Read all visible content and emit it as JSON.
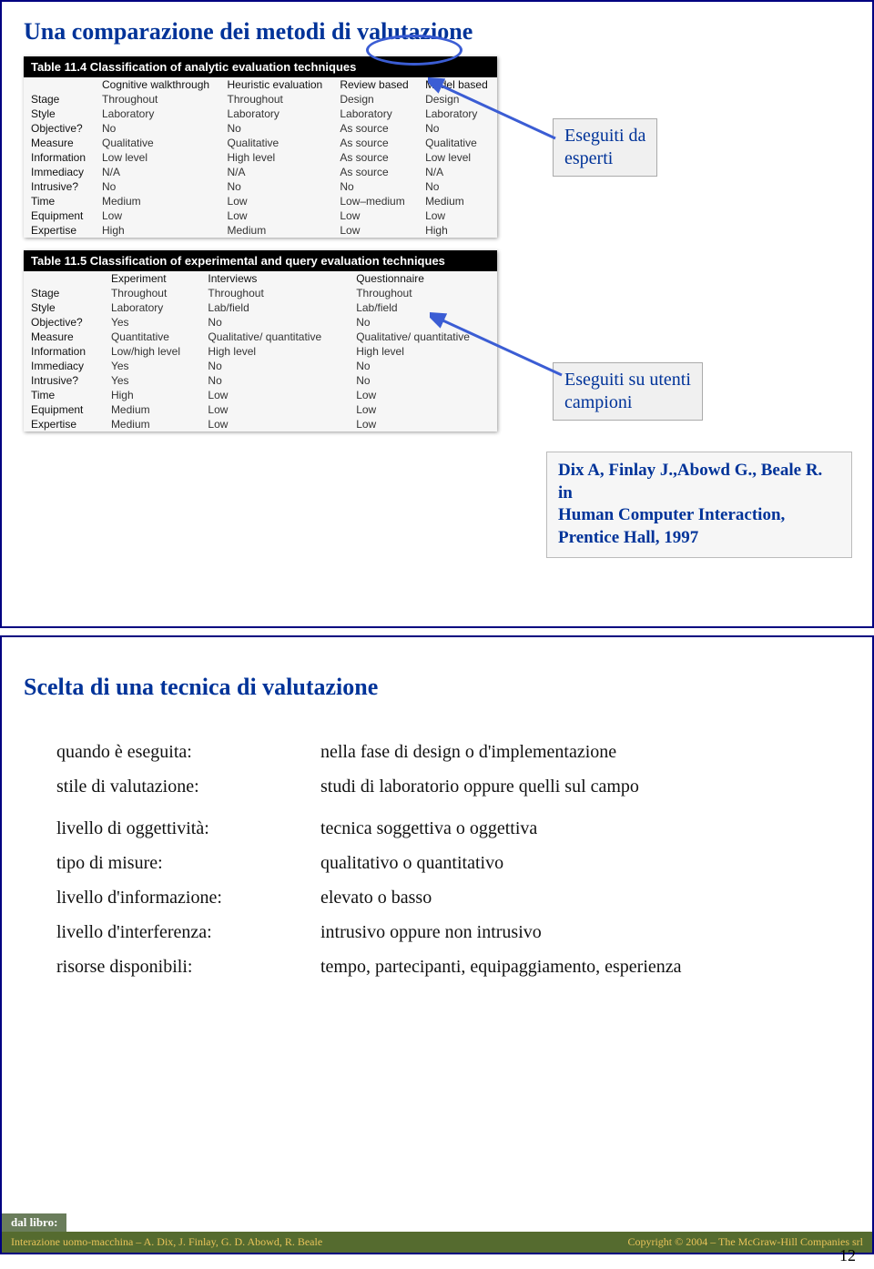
{
  "slide1": {
    "title": "Una comparazione dei metodi di valutazione",
    "callout_experts": "Eseguiti da\nesperti",
    "callout_users": "Eseguiti su utenti\ncampioni",
    "reference": "Dix A, Finlay J.,Abowd G., Beale R. in\nHuman Computer Interaction,\nPrentice Hall, 1997",
    "table114": {
      "caption": "Table 11.4  Classification of analytic evaluation techniques",
      "headers": [
        "",
        "Cognitive walkthrough",
        "Heuristic evaluation",
        "Review based",
        "Model based"
      ],
      "rows": [
        [
          "Stage",
          "Throughout",
          "Throughout",
          "Design",
          "Design"
        ],
        [
          "Style",
          "Laboratory",
          "Laboratory",
          "Laboratory",
          "Laboratory"
        ],
        [
          "Objective?",
          "No",
          "No",
          "As source",
          "No"
        ],
        [
          "Measure",
          "Qualitative",
          "Qualitative",
          "As source",
          "Qualitative"
        ],
        [
          "Information",
          "Low level",
          "High level",
          "As source",
          "Low level"
        ],
        [
          "Immediacy",
          "N/A",
          "N/A",
          "As source",
          "N/A"
        ],
        [
          "Intrusive?",
          "No",
          "No",
          "No",
          "No"
        ],
        [
          "Time",
          "Medium",
          "Low",
          "Low–medium",
          "Medium"
        ],
        [
          "Equipment",
          "Low",
          "Low",
          "Low",
          "Low"
        ],
        [
          "Expertise",
          "High",
          "Medium",
          "Low",
          "High"
        ]
      ]
    },
    "table115": {
      "caption": "Table 11.5  Classification of experimental and query evaluation techniques",
      "headers": [
        "",
        "Experiment",
        "Interviews",
        "Questionnaire"
      ],
      "rows": [
        [
          "Stage",
          "Throughout",
          "Throughout",
          "Throughout"
        ],
        [
          "Style",
          "Laboratory",
          "Lab/field",
          "Lab/field"
        ],
        [
          "Objective?",
          "Yes",
          "No",
          "No"
        ],
        [
          "Measure",
          "Quantitative",
          "Qualitative/ quantitative",
          "Qualitative/ quantitative"
        ],
        [
          "Information",
          "Low/high level",
          "High level",
          "High level"
        ],
        [
          "Immediacy",
          "Yes",
          "No",
          "No"
        ],
        [
          "Intrusive?",
          "Yes",
          "No",
          "No"
        ],
        [
          "Time",
          "High",
          "Low",
          "Low"
        ],
        [
          "Equipment",
          "Medium",
          "Low",
          "Low"
        ],
        [
          "Expertise",
          "Medium",
          "Low",
          "Low"
        ]
      ]
    }
  },
  "slide2": {
    "title": "Scelta di una tecnica di valutazione",
    "rows": [
      {
        "label": "quando è eseguita:",
        "value": "nella fase di design o d'implementazione"
      },
      {
        "label": "stile di valutazione:",
        "value": "studi di laboratorio oppure quelli sul campo"
      },
      {
        "label": "livello di oggettività:",
        "value": "tecnica soggettiva o oggettiva"
      },
      {
        "label": "tipo di misure:",
        "value": "qualitativo o quantitativo"
      },
      {
        "label": "livello d'informazione:",
        "value": "elevato o basso"
      },
      {
        "label": "livello d'interferenza:",
        "value": "intrusivo oppure non intrusivo"
      },
      {
        "label": "risorse disponibili:",
        "value": "tempo, partecipanti, equipaggiamento, esperienza"
      }
    ],
    "footer_tag": "dal libro:",
    "footer_left": "Interazione uomo-macchina – A. Dix, J. Finlay, G. D. Abowd, R. Beale",
    "footer_right": "Copyright © 2004 – The McGraw-Hill Companies srl"
  },
  "page_number": "12"
}
